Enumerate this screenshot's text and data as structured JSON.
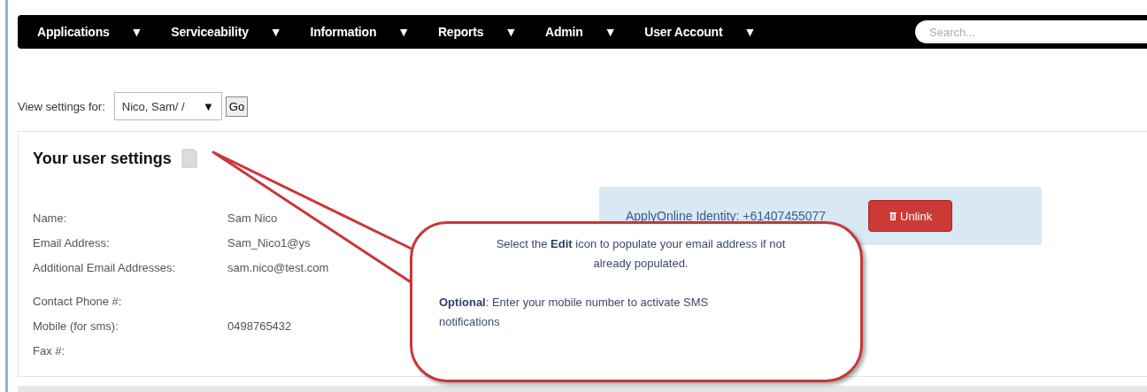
{
  "nav": {
    "items": [
      {
        "label": "Applications",
        "caret": "▼"
      },
      {
        "label": "Serviceability",
        "caret": "▼"
      },
      {
        "label": "Information",
        "caret": "▼"
      },
      {
        "label": "Reports",
        "caret": "▼"
      },
      {
        "label": "Admin",
        "caret": "▼"
      },
      {
        "label": "User Account",
        "caret": "▼"
      }
    ],
    "search": {
      "placeholder": "Search..."
    }
  },
  "view_settings": {
    "label": "View settings for:",
    "select": {
      "value": "Nico, Sam/ /",
      "caret": "▼"
    },
    "go": "Go"
  },
  "user_settings": {
    "title": "Your user settings",
    "field_groups": [
      {
        "fields": [
          {
            "label": "Name:",
            "value": "Sam Nico"
          },
          {
            "label": "Email Address:",
            "value": "Sam_Nico1@ys"
          },
          {
            "label": "Additional Email Addresses:",
            "value": "sam.nico@test.com"
          }
        ]
      },
      {
        "fields": [
          {
            "label": "Contact Phone #:"
          },
          {
            "label": "Mobile (for sms):",
            "value": "0498765432"
          },
          {
            "label": "Fax #:"
          }
        ]
      }
    ],
    "identity": {
      "text": "ApplyOnline Identity: +61407455077",
      "unlink": "Unlink"
    }
  },
  "callout": {
    "paragraphs": [
      "Select the **Edit** icon to populate your email address if not already populated.",
      "**Optional**: Enter your mobile number to activate SMS notifications"
    ]
  }
}
